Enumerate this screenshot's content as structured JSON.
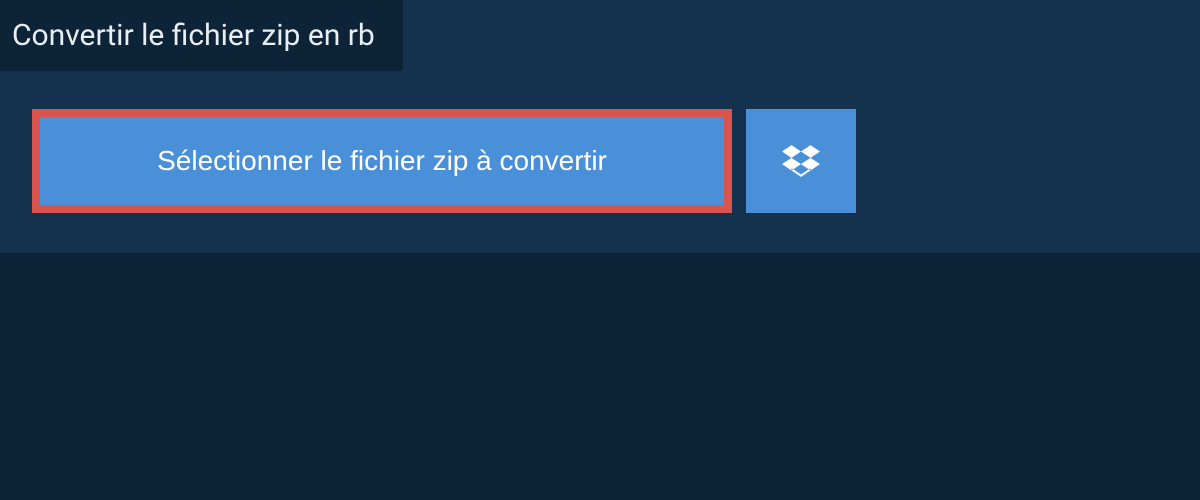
{
  "title": "Convertir le fichier zip en rb",
  "selectButton": "Sélectionner le fichier zip à convertir",
  "colors": {
    "pageBg": "#0d2438",
    "panelBg": "#14324d",
    "buttonBg": "#4a90d9",
    "highlightBorder": "#d9534f",
    "textLight": "#e8eef3"
  }
}
